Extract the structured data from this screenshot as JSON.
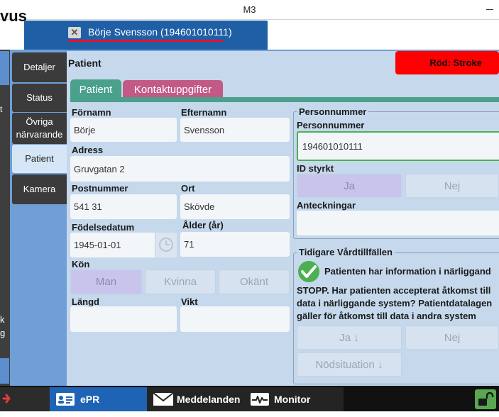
{
  "window": {
    "title": "M3"
  },
  "brand": {
    "partial_text": "vus"
  },
  "patient_tab": {
    "label": "Börje Svensson (194601010111)",
    "underline_color": "#e8102a"
  },
  "left_strip": {
    "text_t": "t",
    "text_k": "k",
    "text_g": "g"
  },
  "nav": {
    "items": [
      {
        "label": "Detaljer"
      },
      {
        "label": "Status"
      },
      {
        "label": "Övriga närvarande"
      },
      {
        "label": "Patient"
      },
      {
        "label": "Kamera"
      }
    ],
    "active": "Patient"
  },
  "content": {
    "title": "Patient"
  },
  "triage": {
    "label": "Röd: Stroke",
    "color": "#ff0000"
  },
  "subtabs": {
    "patient": "Patient",
    "contact": "Kontaktuppgifter"
  },
  "form": {
    "firstname": {
      "label": "Förnamn",
      "value": "Börje"
    },
    "lastname": {
      "label": "Efternamn",
      "value": "Svensson"
    },
    "address": {
      "label": "Adress",
      "value": "Gruvgatan 2"
    },
    "postcode": {
      "label": "Postnummer",
      "value": "541 31"
    },
    "city": {
      "label": "Ort",
      "value": "Skövde"
    },
    "birthdate": {
      "label": "Födelsedatum",
      "value": "1945-01-01"
    },
    "age": {
      "label": "Ålder (år)",
      "value": "71"
    },
    "sex": {
      "label": "Kön",
      "options": [
        "Man",
        "Kvinna",
        "Okänt"
      ],
      "selected": "Man"
    },
    "height": {
      "label": "Längd",
      "value": ""
    },
    "weight": {
      "label": "Vikt",
      "value": ""
    }
  },
  "pnr_group": {
    "title": "Personnummer",
    "pnr": {
      "label": "Personnummer",
      "value": "194601010111"
    },
    "id_verified": {
      "label": "ID styrkt",
      "yes": "Ja",
      "no": "Nej",
      "selected": "Ja"
    },
    "notes": {
      "label": "Anteckningar",
      "value": ""
    }
  },
  "history_group": {
    "title": "Tidigare Vårdtillfällen",
    "info": "Patienten har information i närliggand",
    "stop_line1": "STOPP. Har patienten accepterat åtkomst till",
    "stop_line2": "data i närliggande system? Patientdatalagen",
    "stop_line3": "gäller för åtkomst till data i andra system",
    "yes": "Ja ↓",
    "no": "Nej",
    "emergency": "Nödsituation ↓"
  },
  "bottom": {
    "epr": "ePR",
    "messages": "Meddelanden",
    "monitor": "Monitor"
  },
  "colors": {
    "accent_green": "#4aa08a",
    "accent_pink": "#c25a85",
    "active_tab": "#1f63b5",
    "check_green": "#4cb050"
  }
}
